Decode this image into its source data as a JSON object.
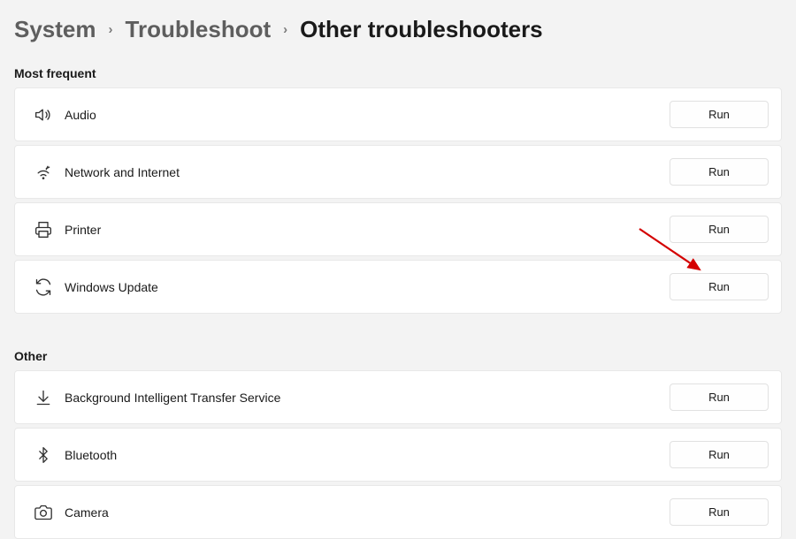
{
  "breadcrumb": {
    "level1": "System",
    "level2": "Troubleshoot",
    "current": "Other troubleshooters"
  },
  "sections": {
    "most_frequent": {
      "header": "Most frequent",
      "items": [
        {
          "icon": "speaker-icon",
          "label": "Audio",
          "button": "Run"
        },
        {
          "icon": "wifi-icon",
          "label": "Network and Internet",
          "button": "Run"
        },
        {
          "icon": "printer-icon",
          "label": "Printer",
          "button": "Run"
        },
        {
          "icon": "refresh-icon",
          "label": "Windows Update",
          "button": "Run"
        }
      ]
    },
    "other": {
      "header": "Other",
      "items": [
        {
          "icon": "download-icon",
          "label": "Background Intelligent Transfer Service",
          "button": "Run"
        },
        {
          "icon": "bluetooth-icon",
          "label": "Bluetooth",
          "button": "Run"
        },
        {
          "icon": "camera-icon",
          "label": "Camera",
          "button": "Run"
        }
      ]
    }
  }
}
